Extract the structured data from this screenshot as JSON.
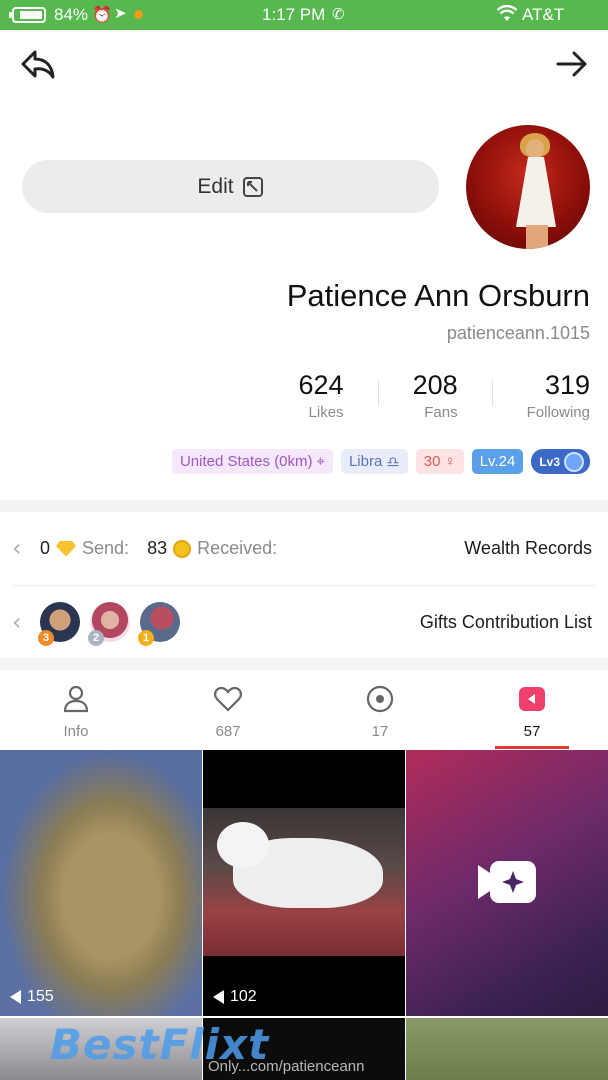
{
  "status_bar": {
    "battery_percent": "84%",
    "battery_level": 0.84,
    "time": "1:17 PM",
    "carrier": "AT&T"
  },
  "nav": {
    "back_icon": "back-arrow-icon",
    "forward_icon": "forward-arrow-icon"
  },
  "profile": {
    "edit_label": "Edit",
    "name": "Patience Ann Orsburn",
    "handle": "patienceann.1015",
    "stats": [
      {
        "value": "319",
        "label": "Following"
      },
      {
        "value": "208",
        "label": "Fans"
      },
      {
        "value": "624",
        "label": "Likes"
      }
    ],
    "tags": {
      "level_badge": "Lv3",
      "level": "Lv.24",
      "age": "30",
      "zodiac": "Libra",
      "location": "United States (0km)"
    }
  },
  "wealth": {
    "title": "Wealth Records",
    "received_label": "Received:",
    "received_value": "83",
    "send_label": "Send:",
    "send_value": "0"
  },
  "gifts": {
    "title": "Gifts Contribution List",
    "ranks": [
      "1",
      "2",
      "3"
    ]
  },
  "tabs": [
    {
      "name": "videos",
      "count": "57",
      "icon": "play-icon"
    },
    {
      "name": "live",
      "count": "17",
      "icon": "record-icon"
    },
    {
      "name": "likes",
      "count": "687",
      "icon": "heart-icon"
    },
    {
      "name": "info",
      "count": "Info",
      "icon": "person-icon"
    }
  ],
  "grid": {
    "tiles": [
      {
        "views": "155"
      },
      {
        "views": "102"
      }
    ],
    "watermark": "BestFlixt",
    "watermark_sub": "Only...com/patienceann"
  },
  "colors": {
    "status_green": "#56b84e",
    "accent_red": "#e53935",
    "tab_active_pink": "#ee3f6d"
  }
}
